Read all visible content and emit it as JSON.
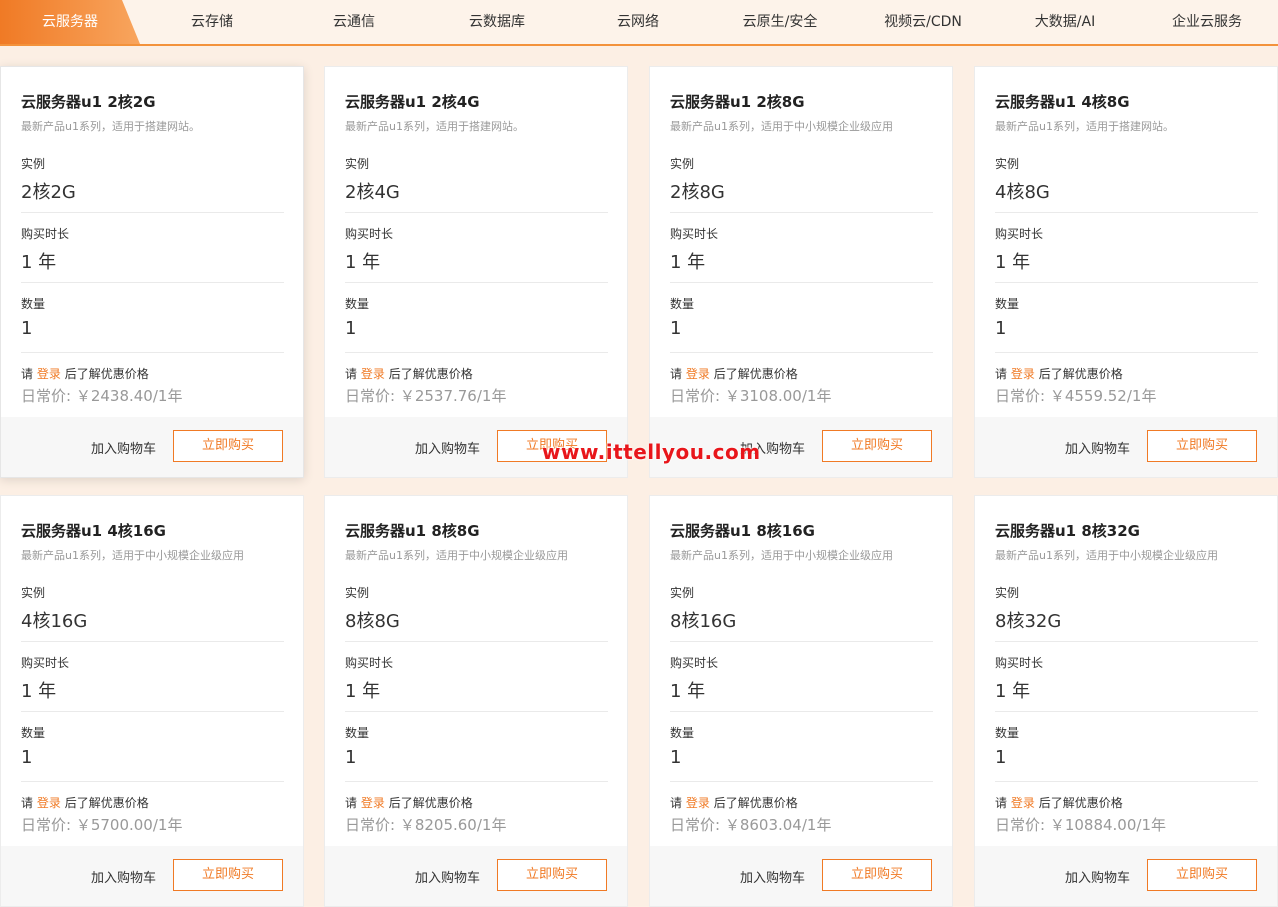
{
  "tabs": [
    {
      "label": "云服务器",
      "active": true
    },
    {
      "label": "云存储"
    },
    {
      "label": "云通信"
    },
    {
      "label": "云数据库"
    },
    {
      "label": "云网络"
    },
    {
      "label": "云原生/安全"
    },
    {
      "label": "视频云/CDN"
    },
    {
      "label": "大数据/AI"
    },
    {
      "label": "企业云服务"
    }
  ],
  "labels": {
    "instance": "实例",
    "duration": "购买时长",
    "quantity": "数量",
    "login_prefix": "请",
    "login_link": "登录",
    "login_suffix": "后了解优惠价格",
    "add_cart": "加入购物车",
    "buy_now": "立即购买"
  },
  "cards": [
    {
      "title": "云服务器u1 2核2G",
      "desc": "最新产品u1系列，适用于搭建网站。",
      "instance": "2核2G",
      "duration": "1 年",
      "quantity": "1",
      "price": "日常价: ￥2438.40/1年"
    },
    {
      "title": "云服务器u1 2核4G",
      "desc": "最新产品u1系列，适用于搭建网站。",
      "instance": "2核4G",
      "duration": "1 年",
      "quantity": "1",
      "price": "日常价: ￥2537.76/1年"
    },
    {
      "title": "云服务器u1 2核8G",
      "desc": "最新产品u1系列，适用于中小规模企业级应用",
      "instance": "2核8G",
      "duration": "1 年",
      "quantity": "1",
      "price": "日常价: ￥3108.00/1年"
    },
    {
      "title": "云服务器u1 4核8G",
      "desc": "最新产品u1系列，适用于搭建网站。",
      "instance": "4核8G",
      "duration": "1 年",
      "quantity": "1",
      "price": "日常价: ￥4559.52/1年"
    },
    {
      "title": "云服务器u1 4核16G",
      "desc": "最新产品u1系列，适用于中小规模企业级应用",
      "instance": "4核16G",
      "duration": "1 年",
      "quantity": "1",
      "price": "日常价: ￥5700.00/1年"
    },
    {
      "title": "云服务器u1 8核8G",
      "desc": "最新产品u1系列，适用于中小规模企业级应用",
      "instance": "8核8G",
      "duration": "1 年",
      "quantity": "1",
      "price": "日常价: ￥8205.60/1年"
    },
    {
      "title": "云服务器u1 8核16G",
      "desc": "最新产品u1系列，适用于中小规模企业级应用",
      "instance": "8核16G",
      "duration": "1 年",
      "quantity": "1",
      "price": "日常价: ￥8603.04/1年"
    },
    {
      "title": "云服务器u1 8核32G",
      "desc": "最新产品u1系列，适用于中小规模企业级应用",
      "instance": "8核32G",
      "duration": "1 年",
      "quantity": "1",
      "price": "日常价: ￥10884.00/1年"
    }
  ],
  "watermark": "www.ittellyou.com",
  "colors": {
    "accent": "#f07a25",
    "background": "#fcefe4"
  }
}
